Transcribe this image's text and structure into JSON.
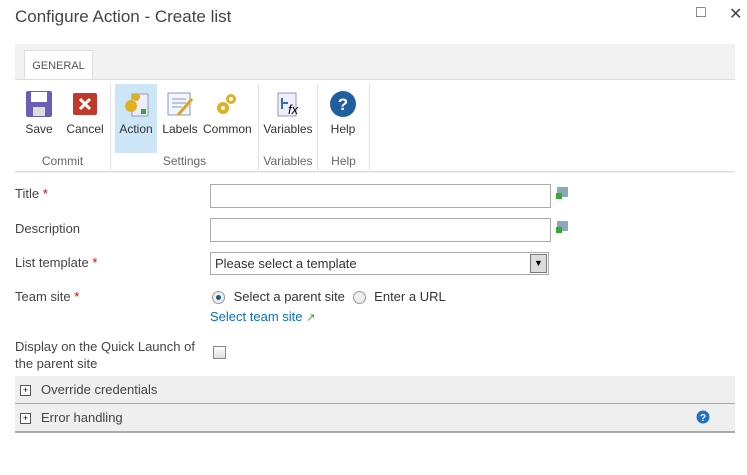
{
  "window": {
    "title": "Configure Action - Create list"
  },
  "ribbon": {
    "tab": "GENERAL",
    "groups": {
      "commit": "Commit",
      "settings": "Settings",
      "variables": "Variables",
      "help": "Help"
    },
    "buttons": {
      "save": "Save",
      "cancel": "Cancel",
      "action": "Action",
      "labels": "Labels",
      "common": "Common",
      "variables": "Variables",
      "help": "Help"
    }
  },
  "form": {
    "title_label": "Title",
    "description_label": "Description",
    "list_template_label": "List template",
    "team_site_label": "Team site",
    "required_mark": "*",
    "title_value": "",
    "description_value": "",
    "list_template_value": "Please select a template",
    "radio_parent": "Select a parent site",
    "radio_url": "Enter a URL",
    "select_team_site": "Select team site",
    "quick_launch_label": "Display on the Quick Launch of the parent site",
    "quick_launch_checked": false
  },
  "sections": {
    "override": "Override credentials",
    "error": "Error handling"
  },
  "colors": {
    "link": "#0072c6",
    "selected": "#cde6f7"
  }
}
